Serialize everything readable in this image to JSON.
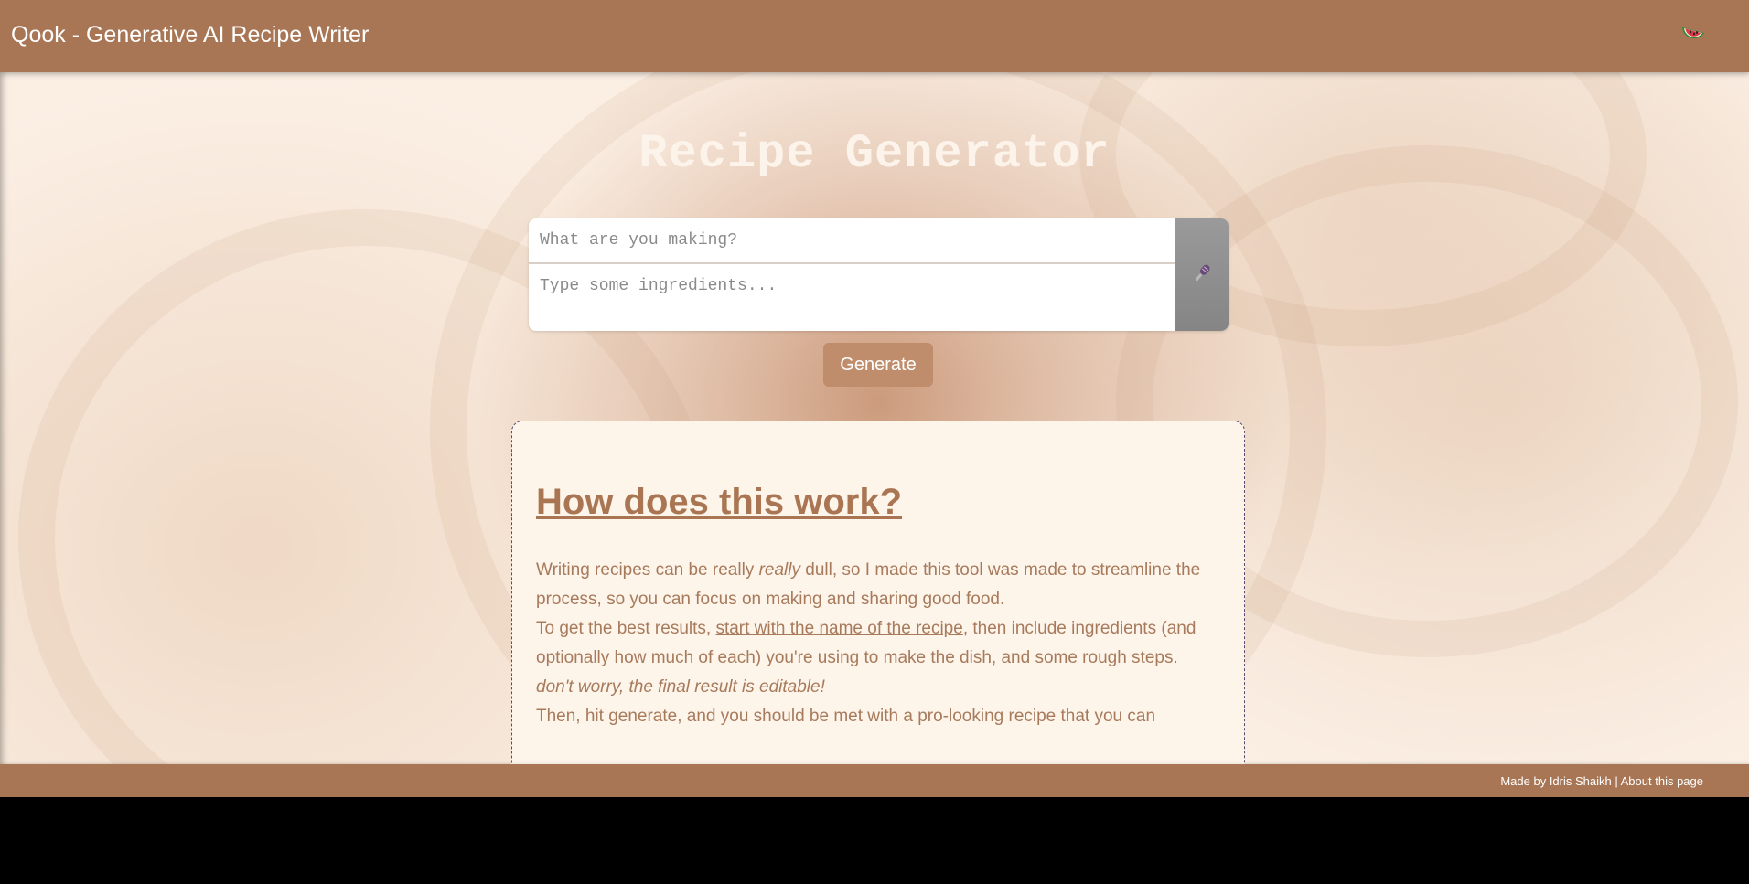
{
  "header": {
    "app_title": "Qook - Generative AI Recipe Writer",
    "theme_icon": "watermelon-icon"
  },
  "main": {
    "title": "Recipe Generator",
    "recipe_name_placeholder": "What are you making?",
    "recipe_name_value": "",
    "ingredients_placeholder": "Type some ingredients...",
    "ingredients_value": "",
    "mic_icon": "microphone-icon",
    "generate_label": "Generate"
  },
  "info": {
    "heading": "How does this work?",
    "p1_before": "Writing recipes can be really ",
    "p1_em": "really",
    "p1_after": " dull, so I made this tool was made to streamline the process, so you can focus on making and sharing good food.",
    "p2_before": "To get the best results, ",
    "p2_link": "start with the name of the recipe",
    "p2_after": ", then include ingredients (and optionally how much of each) you're using to make the dish, and some rough steps.",
    "p3_em": "don't worry, the final result is editable!",
    "p4": "Then, hit generate, and you should be met with a pro-looking recipe that you can"
  },
  "footer": {
    "credit": "Made by Idris Shaikh",
    "separator": " | ",
    "about_link": "About this page"
  },
  "colors": {
    "brand": "#a87654",
    "generate_button": "#bf8d6b",
    "card_background": "#fdf4ea",
    "heading_text": "#a97552",
    "mic_button": "#8f8f8f"
  }
}
